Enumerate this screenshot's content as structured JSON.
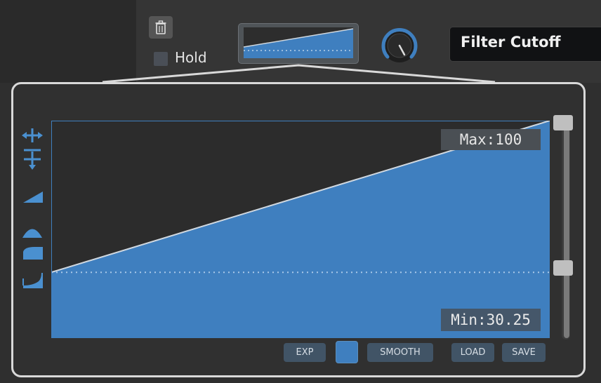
{
  "header": {
    "hold_label": "Hold",
    "hold_checked": false,
    "parameter_name": "Filter Cutoff",
    "knob_value": 0.5
  },
  "editor": {
    "max_label": "Max:100",
    "min_label": "Min:30.25",
    "curve": {
      "start_percent": 30.25,
      "end_percent": 100
    },
    "baseline_percent": 30.25,
    "slider_upper_percent": 100,
    "slider_lower_percent": 30.25
  },
  "tools": [
    {
      "icon": "horizontal-stretch-icon"
    },
    {
      "icon": "vertical-stretch-icon"
    },
    {
      "icon": "ramp-icon"
    },
    {
      "icon": "bell-curve-icon"
    },
    {
      "icon": "ease-in-icon"
    },
    {
      "icon": "ease-out-icon"
    }
  ],
  "buttons": {
    "exp": "EXP",
    "smooth": "SMOOTH",
    "load": "LOAD",
    "save": "SAVE"
  },
  "colors": {
    "accent": "#3f7fbf",
    "panel": "#303030",
    "border": "#d9d9d9"
  }
}
